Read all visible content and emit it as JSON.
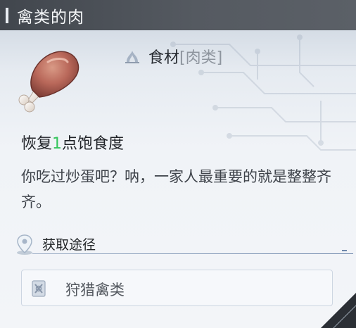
{
  "title": "禽类的肉",
  "category": {
    "main": "食材",
    "sub": "[肉类]"
  },
  "effect": {
    "prefix": "恢复",
    "value": "1",
    "suffix": "点饱食度"
  },
  "description": "你吃过炒蛋吧？呐，一家人最重要的就是整整齐齐。",
  "source": {
    "label": "获取途径",
    "items": [
      "狩猎禽类"
    ]
  },
  "colors": {
    "titlebar": "#4b5057",
    "highlight_green": "#33c45b",
    "panel": "#eef1f5"
  },
  "icons": [
    "meat-leg-icon",
    "ingredient-icon",
    "location-pin-icon",
    "hunting-icon"
  ]
}
